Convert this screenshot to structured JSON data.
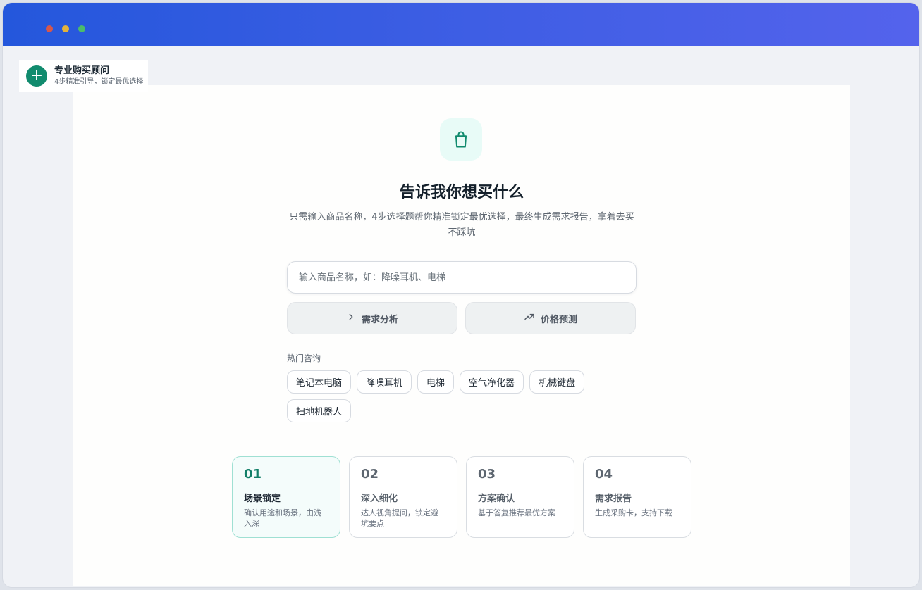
{
  "brand": {
    "title": "专业购买顾问",
    "subtitle": "4步精准引导，锁定最优选择"
  },
  "hero": {
    "icon": "shopping-bag-icon",
    "title": "告诉我你想买什么",
    "description": "只需输入商品名称，4步选择题帮你精准锁定最优选择，最终生成需求报告，拿着去买不踩坑"
  },
  "search": {
    "placeholder": "输入商品名称，如：降噪耳机、电梯",
    "value": ""
  },
  "actions": [
    {
      "label": "需求分析",
      "icon": "chevron-right-icon"
    },
    {
      "label": "价格预测",
      "icon": "trending-up-icon"
    }
  ],
  "hot": {
    "label": "热门咨询",
    "items": [
      "笔记本电脑",
      "降噪耳机",
      "电梯",
      "空气净化器",
      "机械键盘",
      "扫地机器人"
    ]
  },
  "steps": [
    {
      "num": "01",
      "title": "场景锁定",
      "desc": "确认用途和场景，由浅入深",
      "active": true
    },
    {
      "num": "02",
      "title": "深入细化",
      "desc": "达人视角提问，锁定避坑要点",
      "active": false
    },
    {
      "num": "03",
      "title": "方案确认",
      "desc": "基于答复推荐最优方案",
      "active": false
    },
    {
      "num": "04",
      "title": "需求报告",
      "desc": "生成采购卡，支持下载",
      "active": false
    }
  ],
  "colors": {
    "accent": "#118b6e",
    "titlebar_start": "#2457dc",
    "titlebar_end": "#5463ec",
    "hero_icon_bg": "#e8fbf7",
    "step_active_bg": "#f4fcfb",
    "step_active_border": "#9fe0d3"
  }
}
